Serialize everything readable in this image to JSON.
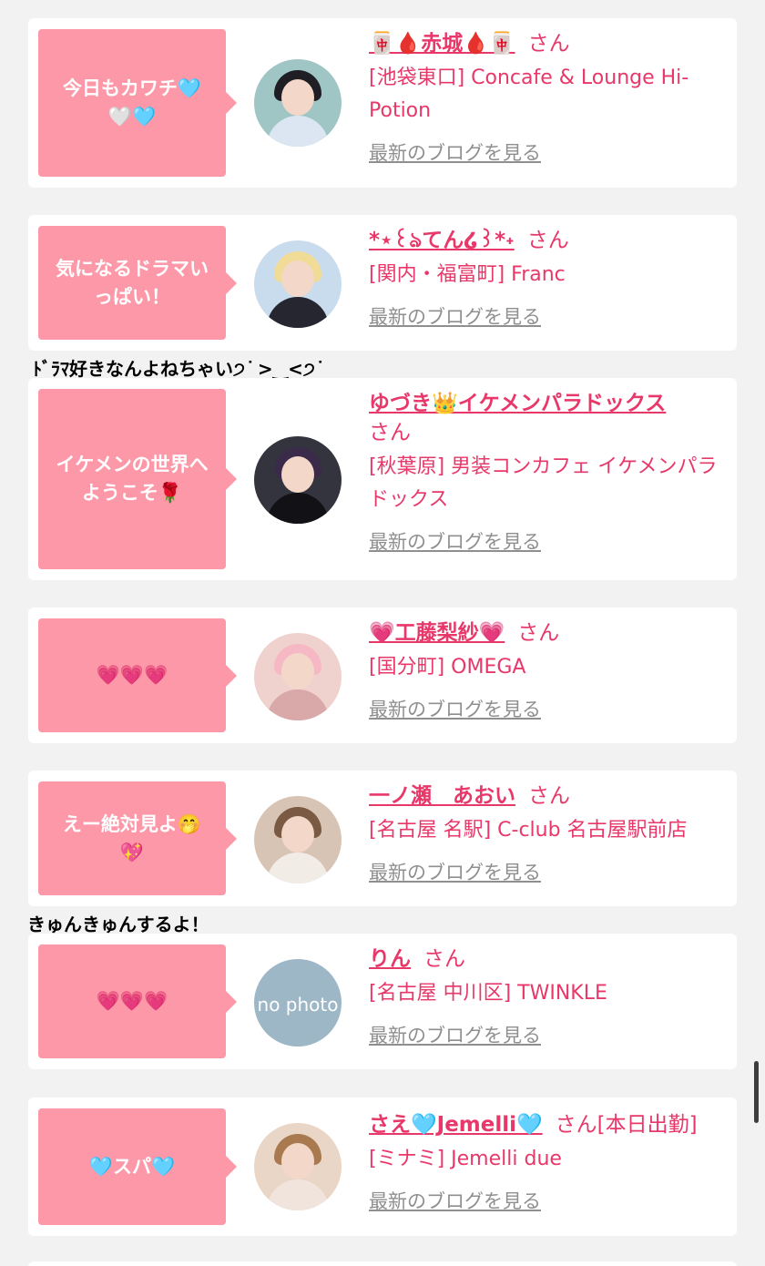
{
  "colors": {
    "page_bg": "#f2f2f2",
    "card_bg": "#ffffff",
    "bubble_bg": "#fd98a8",
    "accent_pink": "#e8386a",
    "link_gray": "#8f8f8f"
  },
  "entries": [
    {
      "bubble_text": "今日もカワチ🩵\n🤍🩵",
      "name": "🀄🩸赤城🩸🀄",
      "honorific": "さん",
      "shop": "[池袋東口] Concafe & Lounge Hi-Potion",
      "blog_link": "最新のブログを見る"
    },
    {
      "bubble_text": "気になるドラマい\nっぱい！",
      "name": "*⋆꒰ঌてん໒꒱*˖",
      "honorific": "さん",
      "shop": "[関内・福富町] Franc",
      "blog_link": "最新のブログを見る"
    },
    {
      "bubble_text": "イケメンの世界へ\nようこそ🌹",
      "name": "ゆづき👑イケメンパラドックス",
      "honorific": "さん",
      "shop": "[秋葉原] 男装コンカフェ イケメンパラドックス",
      "blog_link": "最新のブログを見る"
    },
    {
      "bubble_text": "💗💗💗",
      "name": "💗工藤梨紗💗",
      "honorific": "さん",
      "shop": "[国分町] OMEGA",
      "blog_link": "最新のブログを見る"
    },
    {
      "bubble_text": "えー絶対見よ🤭\n💖",
      "name": "一ノ瀬　あおい",
      "honorific": "さん",
      "shop": "[名古屋 名駅] C-club 名古屋駅前店",
      "blog_link": "最新のブログを見る"
    },
    {
      "bubble_text": "💗💗💗",
      "name": "りん",
      "honorific": "さん",
      "shop": "[名古屋 中川区] TWINKLE",
      "blog_link": "最新のブログを見る",
      "avatar_text": "no photo"
    },
    {
      "bubble_text": "🩵スパ🩵",
      "name": "さえ🩵Jemelli🩵",
      "honorific": "さん",
      "status": "[本日出勤]",
      "shop": "[ミナミ] Jemelli due",
      "blog_link": "最新のブログを見る"
    }
  ],
  "captions": [
    "ﾄﾞﾗﾏ好きなんよねちゃい੭ ͘ >‿<੭ ͘",
    "きゅんきゅんするよ！"
  ]
}
